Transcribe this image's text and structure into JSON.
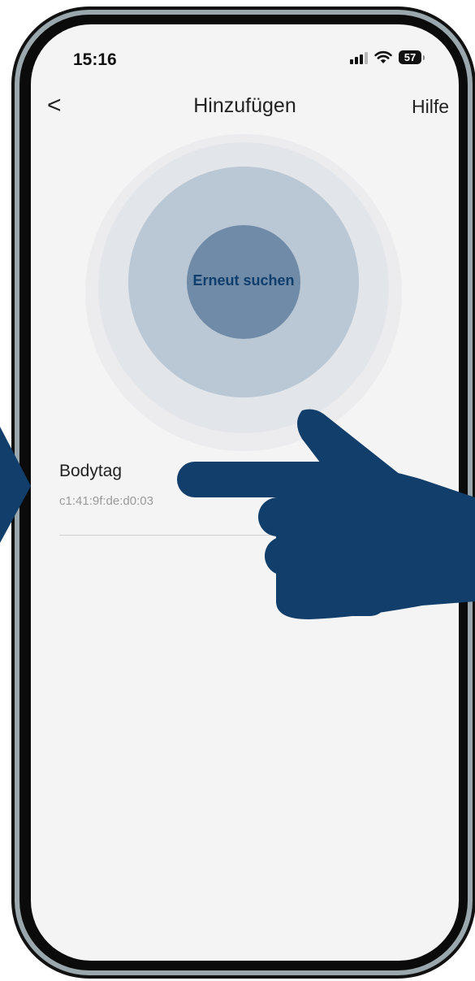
{
  "status_bar": {
    "time": "15:16",
    "battery": "57",
    "icons": [
      "signal-icon",
      "wifi-icon",
      "battery-icon"
    ]
  },
  "nav": {
    "back_icon": "chevron-left-icon",
    "back_glyph": "<",
    "title": "Hinzufügen",
    "help_label": "Hilfe"
  },
  "scan": {
    "rescan_label": "Erneut suchen"
  },
  "devices": [
    {
      "name": "Bodytag",
      "mac": "c1:41:9f:de:d0:03"
    }
  ],
  "annotations": {
    "pointer_icon": "pointing-hand-icon",
    "arrow_icon": "arrow-right-icon",
    "color": "#123e6b"
  },
  "colors": {
    "screen_background": "#f4f4f4",
    "frame": "#111111",
    "frame_ring": "#9aa8ae",
    "scan_inner": "#6f8ba7",
    "scan_mid": "#bac7d4",
    "scan_outer": "#e2e6ea",
    "rescan_text": "#0f3d6c"
  }
}
